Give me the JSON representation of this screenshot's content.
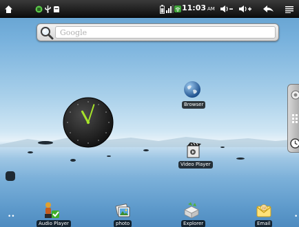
{
  "status_bar": {
    "time": "11:03",
    "ampm": "AM",
    "left_icons": [
      "home-icon",
      "notification-android-icon",
      "usb-icon",
      "sd-card-icon"
    ],
    "right_icons": [
      "battery-icon",
      "signal-icon",
      "wifi-icon",
      "volume-down-icon",
      "volume-up-icon",
      "back-icon",
      "menu-icon"
    ]
  },
  "search": {
    "placeholder": "Google",
    "icon": "search-icon"
  },
  "clock_widget": {
    "hour": 11,
    "minute": 3
  },
  "desktop": {
    "shortcuts": [
      {
        "label": "Browser",
        "icon": "globe-icon"
      },
      {
        "label": "Video Player",
        "icon": "video-player-icon"
      }
    ]
  },
  "dock": {
    "items": [
      {
        "label": "Audio Player",
        "icon": "audio-player-icon"
      },
      {
        "label": "photo",
        "icon": "photo-icon"
      },
      {
        "label": "Explorer",
        "icon": "explorer-icon"
      },
      {
        "label": "Email",
        "icon": "email-icon"
      }
    ]
  },
  "side_drawer": {
    "icons": [
      "gallery-icon",
      "app-grid-icon",
      "clock-icon"
    ]
  },
  "page_indicators": {
    "left": "••",
    "right": "•"
  }
}
